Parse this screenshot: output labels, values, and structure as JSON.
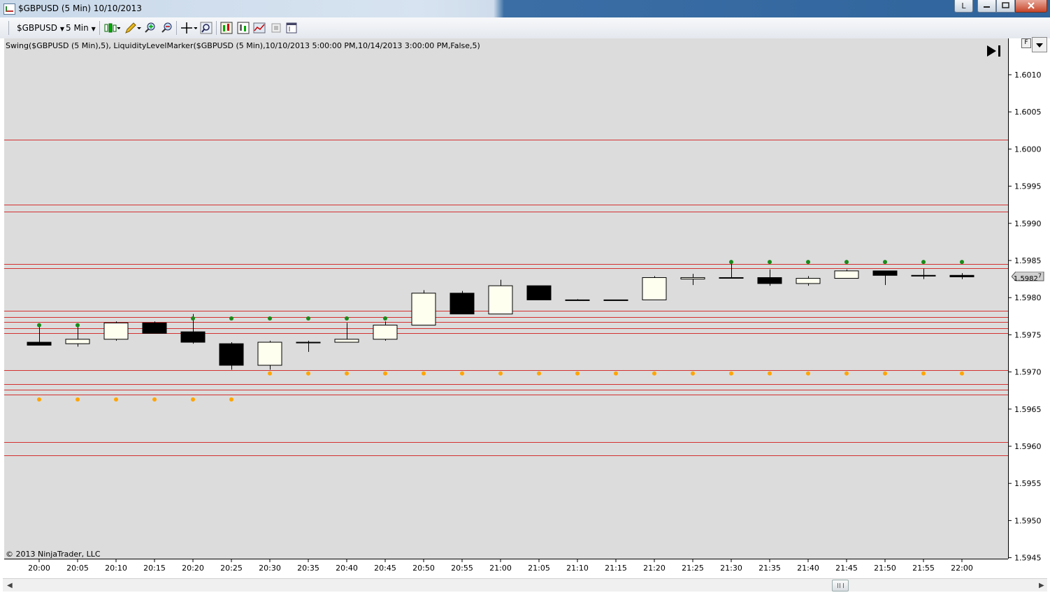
{
  "window": {
    "title": "$GBPUSD (5 Min)  10/10/2013",
    "extra_button": "L",
    "minimize_icon": "minimize-icon",
    "maximize_icon": "maximize-icon",
    "close_icon": "close-icon"
  },
  "toolbar": {
    "instrument": "$GBPUSD",
    "interval": "5 Min",
    "icons": [
      "candlestick-style-icon",
      "pencil-draw-icon",
      "zoom-in-icon",
      "zoom-out-icon",
      "crosshair-icon",
      "magnifier-icon",
      "indicators-icon",
      "strategies-icon",
      "chart-trader-icon",
      "data-box-icon",
      "properties-icon"
    ]
  },
  "chart": {
    "indicator_label": "Swing($GBPUSD (5 Min),5), LiquidityLevelMarker($GBPUSD (5 Min),10/10/2013 5:00:00 PM,10/14/2013 3:00:00 PM,False,5)",
    "copyright": "© 2013 NinjaTrader, LLC",
    "last_price": "1.5982",
    "last_price_suffix": "7",
    "colors": {
      "background": "#dcdcdc",
      "level_line": "#d43030",
      "swing_high": "#1a8a1a",
      "swing_low": "#ffa500",
      "up_body": "#fffff0",
      "down_body": "#000000"
    }
  },
  "chart_data": {
    "type": "candlestick",
    "instrument": "$GBPUSD",
    "interval": "5 Min",
    "x_axis": {
      "tick_labels": [
        "20:00",
        "20:05",
        "20:10",
        "20:15",
        "20:20",
        "20:25",
        "20:30",
        "20:35",
        "20:40",
        "20:45",
        "20:50",
        "20:55",
        "21:00",
        "21:05",
        "21:10",
        "21:15",
        "21:20",
        "21:25",
        "21:30",
        "21:35",
        "21:40",
        "21:45",
        "21:50",
        "21:55",
        "22:00"
      ]
    },
    "y_axis": {
      "range": [
        1.5945,
        1.6013
      ],
      "tick_labels": [
        "1.6010",
        "1.6005",
        "1.6000",
        "1.5995",
        "1.5990",
        "1.5985",
        "1.5980",
        "1.5975",
        "1.5970",
        "1.5965",
        "1.5960",
        "1.5955",
        "1.5950",
        "1.5945"
      ],
      "grid": false
    },
    "candles": [
      {
        "time": "20:00",
        "open": 1.5974,
        "high": 1.59763,
        "low": 1.5974,
        "close": 1.59736
      },
      {
        "time": "20:05",
        "open": 1.59738,
        "high": 1.59763,
        "low": 1.59734,
        "close": 1.59744
      },
      {
        "time": "20:10",
        "open": 1.59744,
        "high": 1.59768,
        "low": 1.59742,
        "close": 1.59766
      },
      {
        "time": "20:15",
        "open": 1.59766,
        "high": 1.59768,
        "low": 1.59752,
        "close": 1.59752
      },
      {
        "time": "20:20",
        "open": 1.59754,
        "high": 1.59778,
        "low": 1.59738,
        "close": 1.5974
      },
      {
        "time": "20:25",
        "open": 1.59738,
        "high": 1.5974,
        "low": 1.59703,
        "close": 1.59709
      },
      {
        "time": "20:30",
        "open": 1.59709,
        "high": 1.59742,
        "low": 1.59703,
        "close": 1.5974
      },
      {
        "time": "20:35",
        "open": 1.5974,
        "high": 1.59742,
        "low": 1.59727,
        "close": 1.5974
      },
      {
        "time": "20:40",
        "open": 1.5974,
        "high": 1.59766,
        "low": 1.5974,
        "close": 1.59744
      },
      {
        "time": "20:45",
        "open": 1.59744,
        "high": 1.59768,
        "low": 1.59742,
        "close": 1.59763
      },
      {
        "time": "20:50",
        "open": 1.59763,
        "high": 1.5981,
        "low": 1.59763,
        "close": 1.59806
      },
      {
        "time": "20:55",
        "open": 1.59806,
        "high": 1.59809,
        "low": 1.59778,
        "close": 1.59778
      },
      {
        "time": "21:00",
        "open": 1.59778,
        "high": 1.59824,
        "low": 1.59778,
        "close": 1.59816
      },
      {
        "time": "21:05",
        "open": 1.59816,
        "high": 1.59816,
        "low": 1.59797,
        "close": 1.59797
      },
      {
        "time": "21:10",
        "open": 1.59797,
        "high": 1.59798,
        "low": 1.59796,
        "close": 1.59797
      },
      {
        "time": "21:15",
        "open": 1.59797,
        "high": 1.59797,
        "low": 1.59797,
        "close": 1.59797
      },
      {
        "time": "21:20",
        "open": 1.59797,
        "high": 1.59829,
        "low": 1.59797,
        "close": 1.59827
      },
      {
        "time": "21:25",
        "open": 1.59825,
        "high": 1.59832,
        "low": 1.59817,
        "close": 1.59827
      },
      {
        "time": "21:30",
        "open": 1.59827,
        "high": 1.59848,
        "low": 1.59826,
        "close": 1.59827
      },
      {
        "time": "21:35",
        "open": 1.59827,
        "high": 1.59838,
        "low": 1.59816,
        "close": 1.59819
      },
      {
        "time": "21:40",
        "open": 1.59819,
        "high": 1.59829,
        "low": 1.59816,
        "close": 1.59826
      },
      {
        "time": "21:45",
        "open": 1.59826,
        "high": 1.59838,
        "low": 1.59826,
        "close": 1.59836
      },
      {
        "time": "21:50",
        "open": 1.59836,
        "high": 1.59836,
        "low": 1.59817,
        "close": 1.5983
      },
      {
        "time": "21:55",
        "open": 1.5983,
        "high": 1.59839,
        "low": 1.59825,
        "close": 1.59829
      },
      {
        "time": "22:00",
        "open": 1.5983,
        "high": 1.59833,
        "low": 1.59825,
        "close": 1.59828
      }
    ],
    "liquidity_levels": [
      1.60013,
      1.59925,
      1.59916,
      1.59845,
      1.5984,
      1.59782,
      1.59774,
      1.59767,
      1.59759,
      1.59752,
      1.59702,
      1.59684,
      1.59676,
      1.5967,
      1.59606,
      1.59588
    ],
    "swing_highs": [
      {
        "time": "20:00",
        "value": 1.59763
      },
      {
        "time": "20:05",
        "value": 1.59763
      },
      {
        "time": "20:20",
        "value": 1.59772
      },
      {
        "time": "20:25",
        "value": 1.59772
      },
      {
        "time": "20:30",
        "value": 1.59772
      },
      {
        "time": "20:35",
        "value": 1.59772
      },
      {
        "time": "20:40",
        "value": 1.59772
      },
      {
        "time": "20:45",
        "value": 1.59772
      },
      {
        "time": "21:30",
        "value": 1.59848
      },
      {
        "time": "21:35",
        "value": 1.59848
      },
      {
        "time": "21:40",
        "value": 1.59848
      },
      {
        "time": "21:45",
        "value": 1.59848
      },
      {
        "time": "21:50",
        "value": 1.59848
      },
      {
        "time": "21:55",
        "value": 1.59848
      },
      {
        "time": "22:00",
        "value": 1.59848
      }
    ],
    "swing_lows": [
      {
        "time": "20:00",
        "value": 1.59663
      },
      {
        "time": "20:05",
        "value": 1.59663
      },
      {
        "time": "20:10",
        "value": 1.59663
      },
      {
        "time": "20:15",
        "value": 1.59663
      },
      {
        "time": "20:20",
        "value": 1.59663
      },
      {
        "time": "20:25",
        "value": 1.59663
      },
      {
        "time": "20:30",
        "value": 1.59698
      },
      {
        "time": "20:35",
        "value": 1.59698
      },
      {
        "time": "20:40",
        "value": 1.59698
      },
      {
        "time": "20:45",
        "value": 1.59698
      },
      {
        "time": "20:50",
        "value": 1.59698
      },
      {
        "time": "20:55",
        "value": 1.59698
      },
      {
        "time": "21:00",
        "value": 1.59698
      },
      {
        "time": "21:05",
        "value": 1.59698
      },
      {
        "time": "21:10",
        "value": 1.59698
      },
      {
        "time": "21:15",
        "value": 1.59698
      },
      {
        "time": "21:20",
        "value": 1.59698
      },
      {
        "time": "21:25",
        "value": 1.59698
      },
      {
        "time": "21:30",
        "value": 1.59698
      },
      {
        "time": "21:35",
        "value": 1.59698
      },
      {
        "time": "21:40",
        "value": 1.59698
      },
      {
        "time": "21:45",
        "value": 1.59698
      },
      {
        "time": "21:50",
        "value": 1.59698
      },
      {
        "time": "21:55",
        "value": 1.59698
      },
      {
        "time": "22:00",
        "value": 1.59698
      }
    ]
  }
}
